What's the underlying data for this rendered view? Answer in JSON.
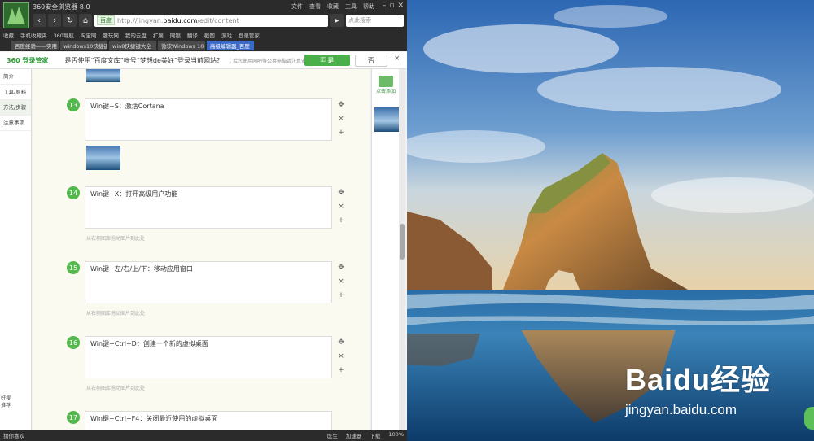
{
  "browser": {
    "title": "360安全浏览器 8.0",
    "menu": [
      "文件",
      "查看",
      "收藏",
      "工具",
      "帮助"
    ],
    "address": {
      "tag": "百度",
      "url_prefix": "http://jingyan.",
      "url_domain": "baidu.com",
      "url_path": "/edit/content"
    },
    "search_placeholder": "点此搜索",
    "bookmarks": [
      "收藏",
      "手机收藏夹",
      "360导航",
      "淘宝网",
      "趣玩网",
      "我的云盘",
      "扩展",
      "网银",
      "翻译",
      "截图",
      "游戏",
      "登录管家"
    ],
    "tabs": [
      "百度经验——实用",
      "windows10快捷键",
      "win8快捷键大全",
      "微软Windows 10",
      "高级编辑器_百度"
    ],
    "active_tab_index": 4
  },
  "login_bar": {
    "brand": "360 登录管家",
    "question": "是否使用“百度文库”帐号“梦想de美好”登录当前网站？",
    "note": "（ 若您使用网吧等公共电脑请注意安",
    "yes": "是",
    "no": "否",
    "close": "×"
  },
  "left_nav": [
    "简介",
    "工具/原料",
    "方法/步骤",
    "注意事项"
  ],
  "left_nav_active": 2,
  "recommend": "好搜推荐",
  "steps": [
    {
      "num": "13",
      "text": "Win键+S：激活Cortana"
    },
    {
      "num": "14",
      "text": "Win键+X：打开高级用户功能"
    },
    {
      "num": "15",
      "text": "Win键+左/右/上/下：移动应用窗口"
    },
    {
      "num": "16",
      "text": "Win键+Ctrl+D：创建一个新的虚拟桌面"
    },
    {
      "num": "17",
      "text": "Win键+Ctrl+F4：关闭最近使用的虚拟桌面"
    }
  ],
  "image_hint": "从右侧图库拖动图片到此处",
  "right_panel": {
    "add_image": "点击添加"
  },
  "status": {
    "left": "猜你喜欢",
    "items": [
      "医生",
      "加速器",
      "下载",
      "100%"
    ]
  },
  "watermark": {
    "main": "Baidu经验",
    "sub": "jingyan.baidu.com"
  }
}
